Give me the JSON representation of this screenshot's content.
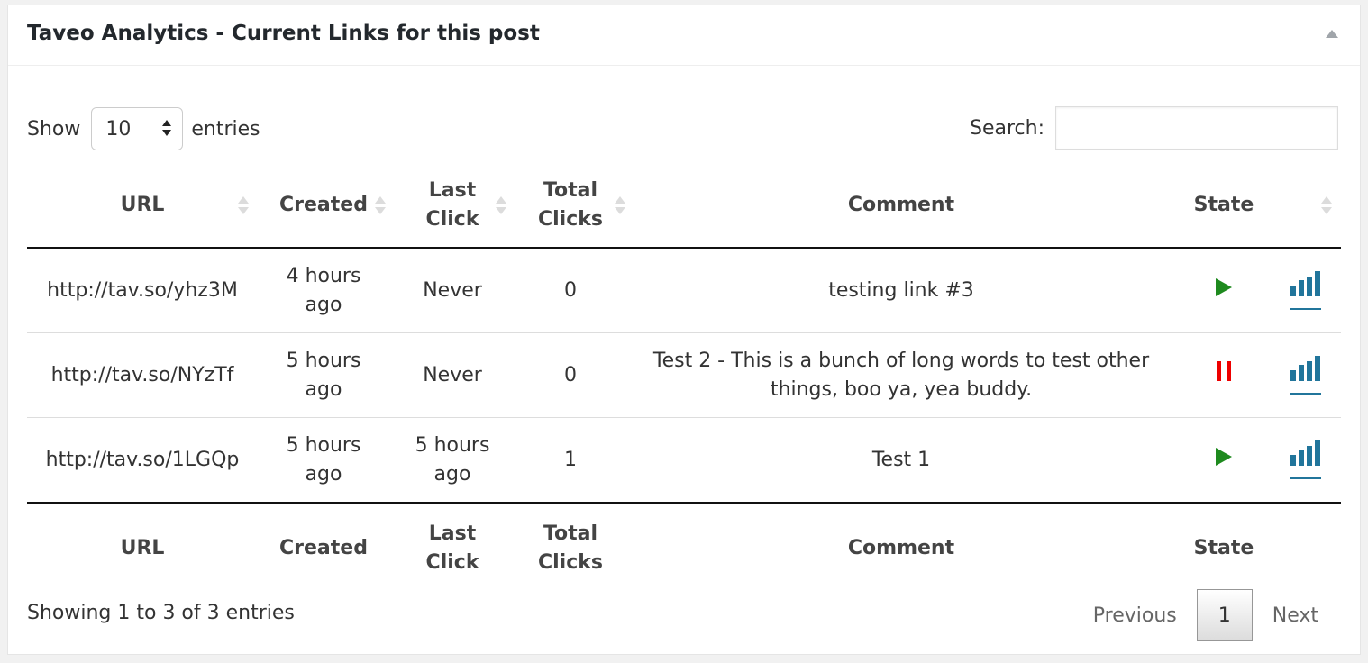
{
  "panel": {
    "title": "Taveo Analytics - Current Links for this post"
  },
  "length": {
    "label_before": "Show",
    "value": "10",
    "label_after": "entries"
  },
  "search": {
    "label": "Search:",
    "value": ""
  },
  "columns": [
    "URL",
    "Created",
    "Last\nClick",
    "Total\nClicks",
    "Comment",
    "State",
    ""
  ],
  "rows": [
    {
      "url": "http://tav.so/yhz3M",
      "created": "4 hours ago",
      "last_click": "Never",
      "total_clicks": "0",
      "comment": "testing link #3",
      "state": "play-icon"
    },
    {
      "url": "http://tav.so/NYzTf",
      "created": "5 hours ago",
      "last_click": "Never",
      "total_clicks": "0",
      "comment": "Test 2 - This is a bunch of long words to test other things, boo ya, yea buddy.",
      "state": "pause-icon"
    },
    {
      "url": "http://tav.so/1LGQp",
      "created": "5 hours ago",
      "last_click": "5 hours ago",
      "total_clicks": "1",
      "comment": "Test 1",
      "state": "play-icon"
    }
  ],
  "info": "Showing 1 to 3 of 3 entries",
  "pagination": {
    "previous": "Previous",
    "current": "1",
    "next": "Next"
  },
  "colors": {
    "play": "#1e8a1e",
    "pause": "#ee0000",
    "stats": "#21759b"
  }
}
